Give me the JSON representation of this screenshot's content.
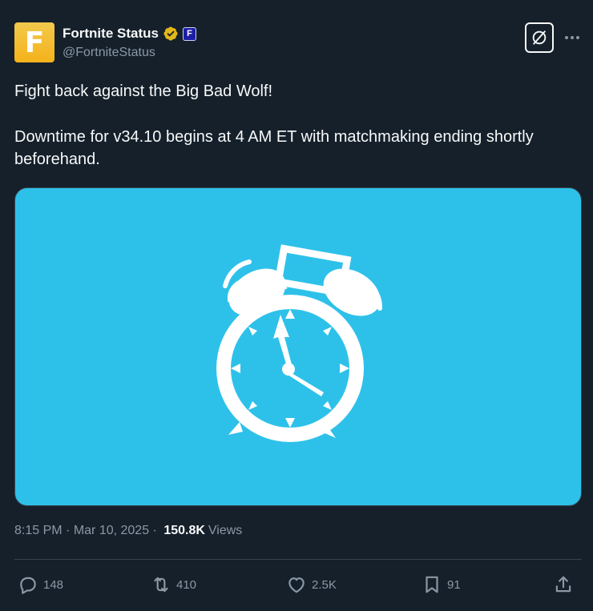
{
  "author": {
    "display_name": "Fortnite Status",
    "handle": "@FortniteStatus",
    "avatar_letter": "F",
    "affiliate_badge_letter": "F",
    "avatar_color": "#f5b21b",
    "verified_color": "#e2b719"
  },
  "header": {
    "grok_icon": "grok-slash-circle-icon",
    "more_icon": "more-horizontal-icon"
  },
  "post": {
    "line1": "Fight back against the Big Bad Wolf!",
    "line2": "Downtime for v34.10 begins at 4 AM ET with matchmaking ending shortly beforehand.",
    "media": {
      "icon": "alarm-clock-icon",
      "background_color": "#2dc1ea"
    }
  },
  "meta": {
    "time": "8:15 PM",
    "sep1": " · ",
    "date": "Mar 10, 2025",
    "sep2": " · ",
    "views_count": "150.8K",
    "views_label": "Views"
  },
  "actions": {
    "replies": "148",
    "reposts": "410",
    "likes": "2.5K",
    "bookmarks": "91"
  },
  "colors": {
    "background": "#15202b",
    "text": "#f7f9f9",
    "muted": "#8b98a5",
    "border": "#38444d"
  }
}
